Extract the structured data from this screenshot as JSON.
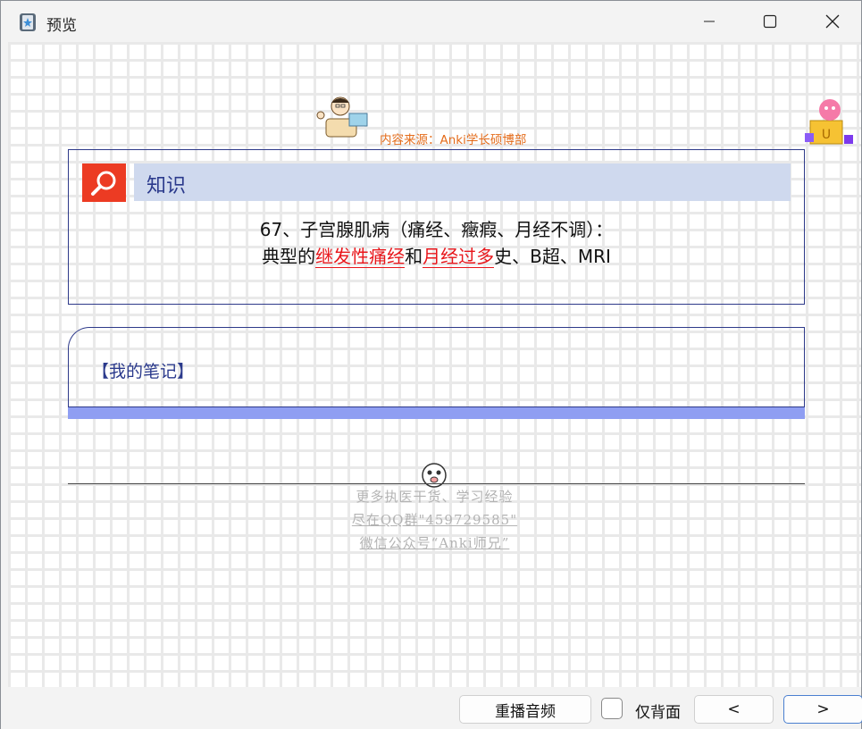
{
  "window": {
    "title": "预览"
  },
  "card": {
    "source": "内容来源：Anki学长硕博部",
    "heading": "知识",
    "line1": "67、子宫腺肌病（痛经、癥瘕、月经不调）：",
    "line2_prefix": "典型的",
    "line2_hl1": "继发性痛经",
    "line2_mid": "和",
    "line2_hl2": "月经过多",
    "line2_suffix": "史、B超、MRI"
  },
  "notes": {
    "label": "【我的笔记】"
  },
  "footer": {
    "line1": "更多执医干货、学习经验",
    "line2": "尽在QQ群\"459729585\"",
    "line3": "微信公众号“Anki师兄”"
  },
  "bottombar": {
    "replay_audio": "重播音频",
    "back_only": "仅背面",
    "prev": "<",
    "next": ">"
  },
  "colors": {
    "accent_red": "#e8161b",
    "heading_blue": "#2b3a8c",
    "source_orange": "#e46c1b"
  }
}
